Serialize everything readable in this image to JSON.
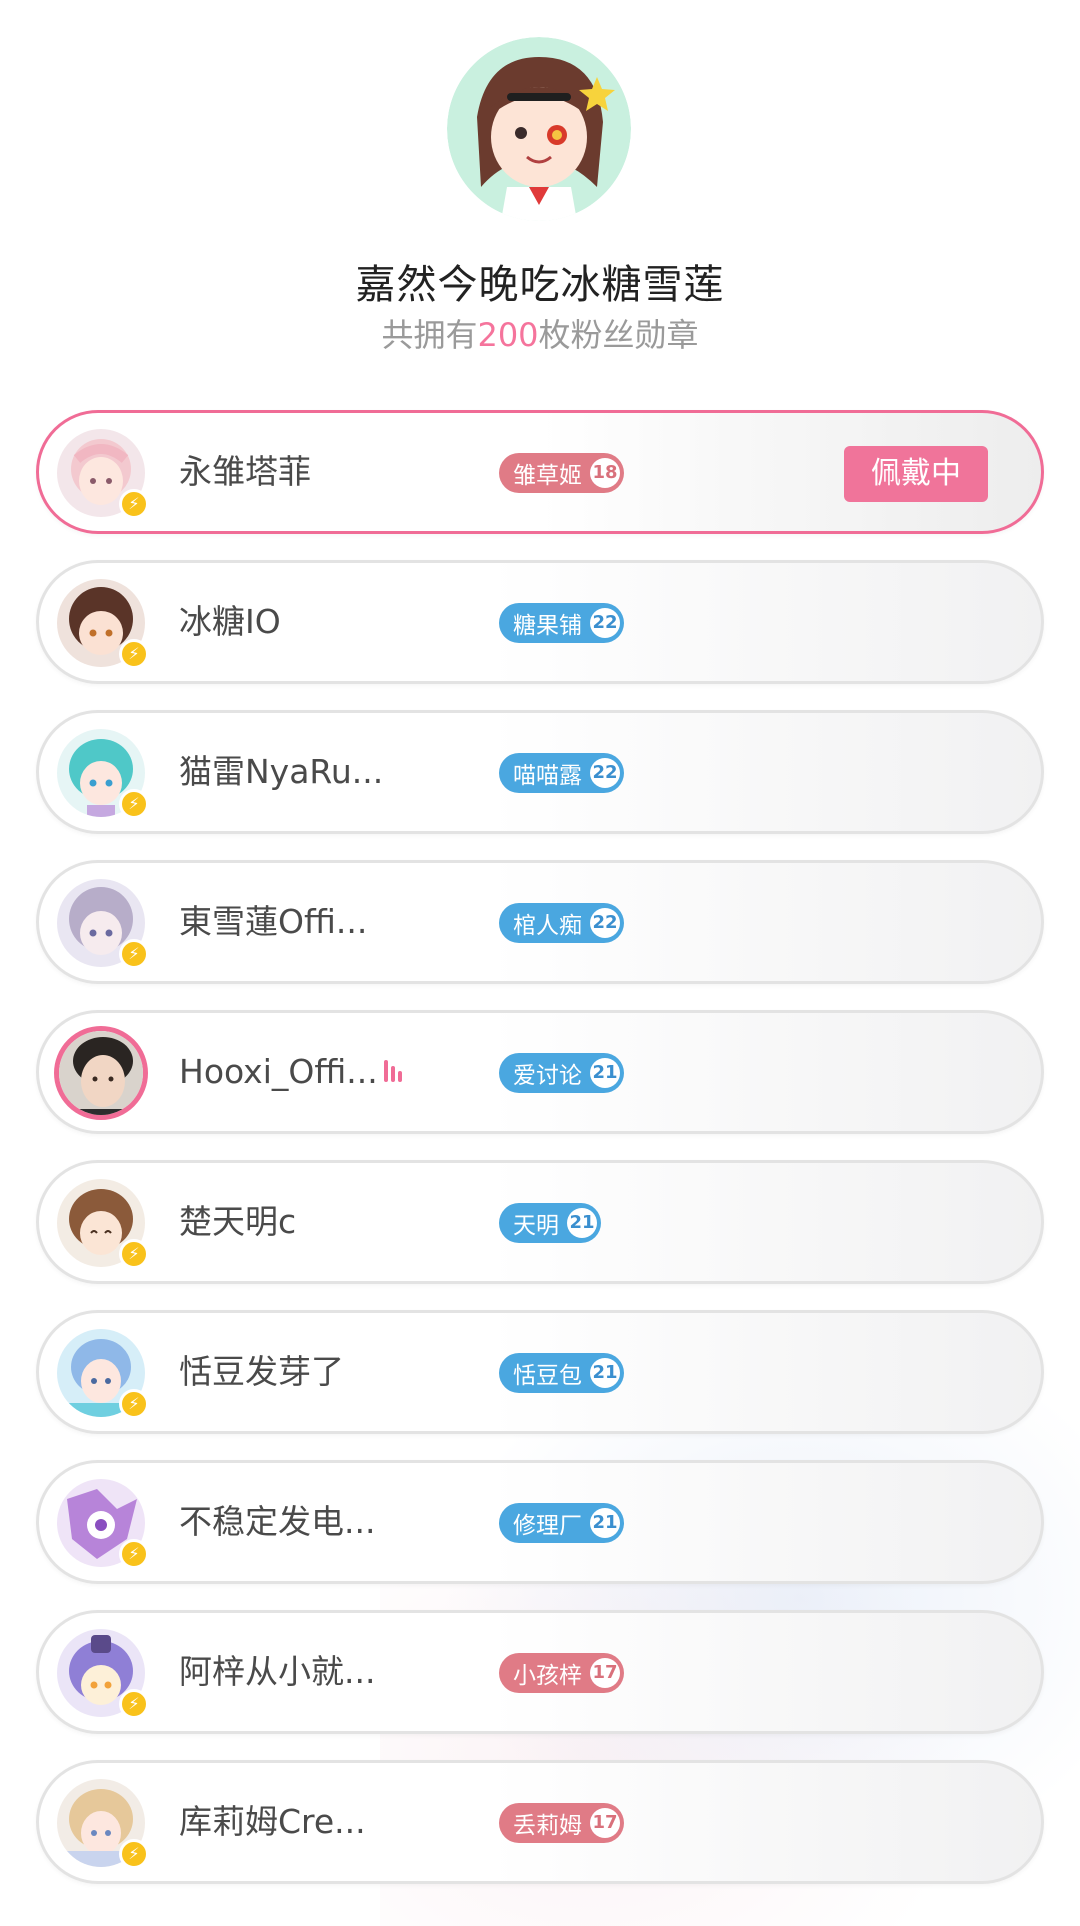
{
  "header": {
    "user_name": "嘉然今晚吃冰糖雪莲",
    "summary_prefix": "共拥有",
    "medal_count": "200",
    "summary_suffix": "枚粉丝勋章"
  },
  "colors": {
    "accent_pink": "#f06c96",
    "medal_pink": "#e07b86",
    "medal_blue": "#4aa7e0",
    "bolt_yellow": "#f9c21b"
  },
  "medals": [
    {
      "streamer": "永雏塔菲",
      "medal_name": "雏草姬",
      "level": "18",
      "color": "pink",
      "wearing_label": "佩戴中",
      "live": false
    },
    {
      "streamer": "冰糖IO",
      "medal_name": "糖果铺",
      "level": "22",
      "color": "blue",
      "live": false
    },
    {
      "streamer": "猫雷NyaRu...",
      "medal_name": "喵喵露",
      "level": "22",
      "color": "blue",
      "live": false
    },
    {
      "streamer": "東雪蓮Offi...",
      "medal_name": "棺人痴",
      "level": "22",
      "color": "blue",
      "live": false
    },
    {
      "streamer": "Hooxi_Offi...",
      "medal_name": "爱讨论",
      "level": "21",
      "color": "blue",
      "live": true
    },
    {
      "streamer": "楚天明c",
      "medal_name": "天明",
      "level": "21",
      "color": "blue",
      "live": false
    },
    {
      "streamer": "恬豆发芽了",
      "medal_name": "恬豆包",
      "level": "21",
      "color": "blue",
      "live": false
    },
    {
      "streamer": "不稳定发电...",
      "medal_name": "修理厂",
      "level": "21",
      "color": "blue",
      "live": false
    },
    {
      "streamer": "阿梓从小就...",
      "medal_name": "小孩梓",
      "level": "17",
      "color": "pink",
      "live": false
    },
    {
      "streamer": "库莉姆Cre...",
      "medal_name": "丢莉姆",
      "level": "17",
      "color": "pink",
      "live": false
    }
  ],
  "icons": {
    "badge": "lightning-bolt-icon",
    "live": "live-bars-icon"
  }
}
